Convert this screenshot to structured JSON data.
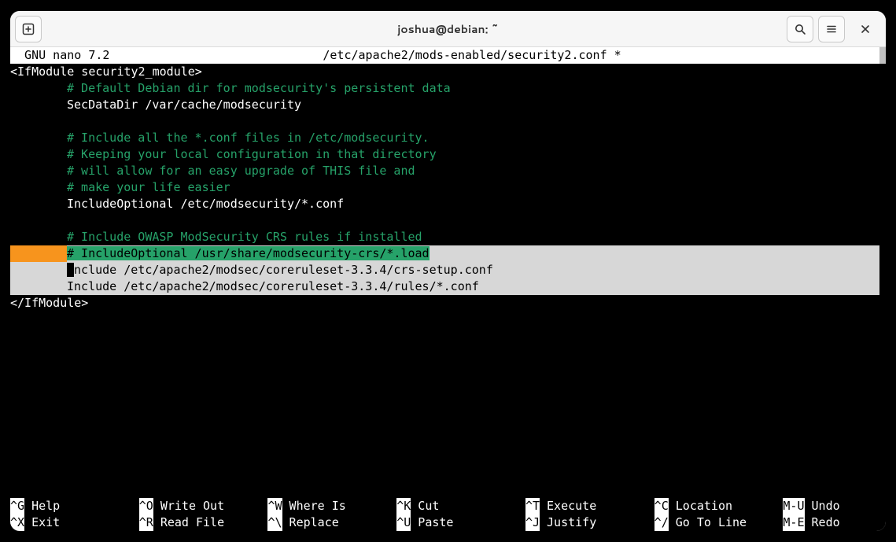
{
  "titlebar": {
    "title": "joshua@debian: ~"
  },
  "nano": {
    "header_left": "  GNU nano 7.2",
    "header_center": "/etc/apache2/mods-enabled/security2.conf *"
  },
  "lines": {
    "l0": "<IfModule security2_module>",
    "l1": "# Default Debian dir for modsecurity's persistent data",
    "l2": "SecDataDir /var/cache/modsecurity",
    "l3": "# Include all the *.conf files in /etc/modsecurity.",
    "l4": "# Keeping your local configuration in that directory",
    "l5": "# will allow for an easy upgrade of THIS file and",
    "l6": "# make your life easier",
    "l7": "IncludeOptional /etc/modsecurity/*.conf",
    "l8": "# Include OWASP ModSecurity CRS rules if installed",
    "l9": "# IncludeOptional /usr/share/modsecurity-crs/*.load",
    "l10a": "I",
    "l10b": "nclude /etc/apache2/modsec/coreruleset-3.3.4/crs-setup.conf",
    "l11": "Include /etc/apache2/modsec/coreruleset-3.3.4/rules/*.conf",
    "l12": "</IfModule>"
  },
  "shortcuts": {
    "row1": [
      {
        "key": "^G",
        "label": " Help"
      },
      {
        "key": "^O",
        "label": " Write Out"
      },
      {
        "key": "^W",
        "label": " Where Is"
      },
      {
        "key": "^K",
        "label": " Cut"
      },
      {
        "key": "^T",
        "label": " Execute"
      },
      {
        "key": "^C",
        "label": " Location"
      },
      {
        "key": "M-U",
        "label": " Undo"
      }
    ],
    "row2": [
      {
        "key": "^X",
        "label": " Exit"
      },
      {
        "key": "^R",
        "label": " Read File"
      },
      {
        "key": "^\\",
        "label": " Replace"
      },
      {
        "key": "^U",
        "label": " Paste"
      },
      {
        "key": "^J",
        "label": " Justify"
      },
      {
        "key": "^/",
        "label": " Go To Line"
      },
      {
        "key": "M-E",
        "label": " Redo"
      }
    ]
  }
}
